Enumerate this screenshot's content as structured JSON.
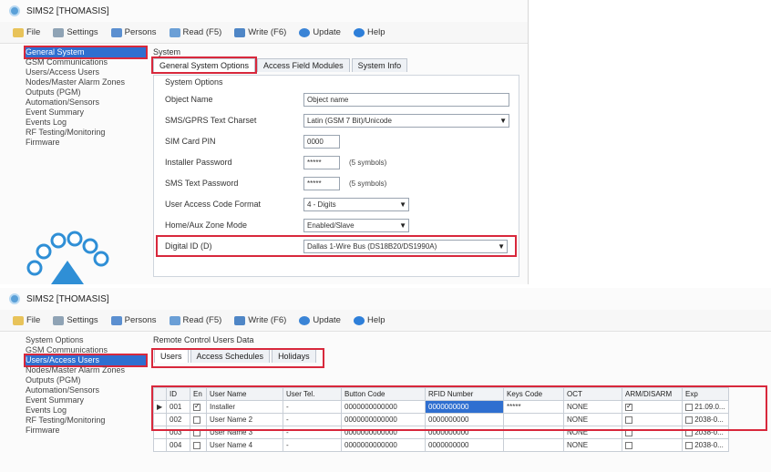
{
  "window1": {
    "title": "SIMS2 [THOMASIS]",
    "menu": [
      "File",
      "Settings",
      "Persons",
      "Read (F5)",
      "Write (F6)",
      "Update",
      "Help"
    ],
    "sidebar": [
      "General System",
      "GSM Communications",
      "Users/Access Users",
      "Nodes/Master Alarm Zones",
      "Outputs (PGM)",
      "Automation/Sensors",
      "Event Summary",
      "Events Log",
      "RF Testing/Monitoring",
      "Firmware"
    ],
    "panel_caption": "System",
    "tabs": [
      "General System Options",
      "Access Field Modules",
      "System Info"
    ],
    "group_title": "System Options",
    "fields": [
      {
        "label": "Object Name",
        "value": "Object name",
        "kind": "input"
      },
      {
        "label": "SMS/GPRS Text Charset",
        "value": "Latin (GSM 7 Bit)/Unicode",
        "kind": "select"
      },
      {
        "label": "SIM Card PIN",
        "value": "0000",
        "kind": "input"
      },
      {
        "label": "Installer Password",
        "value": "*****",
        "kind": "input",
        "hint": "(5 symbols)"
      },
      {
        "label": "SMS Text Password",
        "value": "*****",
        "kind": "input",
        "hint": "(5 symbols)"
      },
      {
        "label": "User Access Code Format",
        "value": "4 - Digits",
        "kind": "select"
      },
      {
        "label": "Home/Aux Zone Mode",
        "value": "Enabled/Slave",
        "kind": "select"
      },
      {
        "label": "Digital ID (D)",
        "value": "Dallas 1-Wire Bus (DS18B20/DS1990A)",
        "kind": "select"
      }
    ]
  },
  "window2": {
    "title": "SIMS2 [THOMASIS]",
    "menu": [
      "File",
      "Settings",
      "Persons",
      "Read (F5)",
      "Write (F6)",
      "Update",
      "Help"
    ],
    "sidebar": [
      "System Options",
      "GSM Communications",
      "Users/Access Users",
      "Nodes/Master Alarm Zones",
      "Outputs (PGM)",
      "Automation/Sensors",
      "Event Summary",
      "Events Log",
      "RF Testing/Monitoring",
      "Firmware"
    ],
    "panel_caption": "Remote Control Users Data",
    "tabs": [
      "Users",
      "Access Schedules",
      "Holidays"
    ],
    "columns": [
      "ID",
      "En",
      "User Name",
      "User Tel.",
      "Button Code",
      "RFID Number",
      "Keys Code",
      "OCT",
      "ARM/DISARM",
      "Exp"
    ],
    "rows": [
      {
        "id": "001",
        "en": true,
        "name": "Installer",
        "tel": "-",
        "btn": "0000000000000",
        "rfid": "0000000000",
        "keys": "*****",
        "oct": "NONE",
        "arm": true,
        "exp": false,
        "expd": "21.09.0..."
      },
      {
        "id": "002",
        "en": false,
        "name": "User Name 2",
        "tel": "-",
        "btn": "0000000000000",
        "rfid": "0000000000",
        "keys": "",
        "oct": "NONE",
        "arm": false,
        "exp": false,
        "expd": "2038-0..."
      },
      {
        "id": "003",
        "en": false,
        "name": "User Name 3",
        "tel": "-",
        "btn": "0000000000000",
        "rfid": "0000000000",
        "keys": "",
        "oct": "NONE",
        "arm": false,
        "exp": false,
        "expd": "2038-0..."
      },
      {
        "id": "004",
        "en": false,
        "name": "User Name 4",
        "tel": "-",
        "btn": "0000000000000",
        "rfid": "0000000000",
        "keys": "",
        "oct": "NONE",
        "arm": false,
        "exp": false,
        "expd": "2038-0..."
      }
    ]
  }
}
